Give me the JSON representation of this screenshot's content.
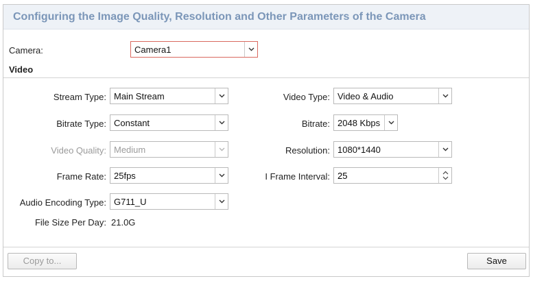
{
  "header": {
    "title": "Configuring the Image Quality, Resolution and Other Parameters of the Camera"
  },
  "camera": {
    "label": "Camera:",
    "value": "Camera1"
  },
  "section": {
    "video": "Video"
  },
  "fields": {
    "stream_type": {
      "label": "Stream Type:",
      "value": "Main Stream"
    },
    "video_type": {
      "label": "Video Type:",
      "value": "Video & Audio"
    },
    "bitrate_type": {
      "label": "Bitrate Type:",
      "value": "Constant"
    },
    "bitrate": {
      "label": "Bitrate:",
      "value": "2048 Kbps"
    },
    "video_quality": {
      "label": "Video Quality:",
      "value": "Medium"
    },
    "resolution": {
      "label": "Resolution:",
      "value": "1080*1440"
    },
    "frame_rate": {
      "label": "Frame Rate:",
      "value": "25fps"
    },
    "i_frame_interval": {
      "label": "I Frame Interval:",
      "value": "25"
    },
    "audio_encoding": {
      "label": "Audio Encoding Type:",
      "value": "G711_U"
    },
    "file_size": {
      "label": "File Size Per Day:",
      "value": "21.0G"
    }
  },
  "footer": {
    "copy_label": "Copy to...",
    "save_label": "Save"
  },
  "colors": {
    "header_bg": "#eef2f7",
    "title": "#7b96b8",
    "focus_border": "#d9685f"
  },
  "icons": {
    "dropdown": "chevron-down-icon",
    "spinner": "spinner-arrows-icon"
  }
}
